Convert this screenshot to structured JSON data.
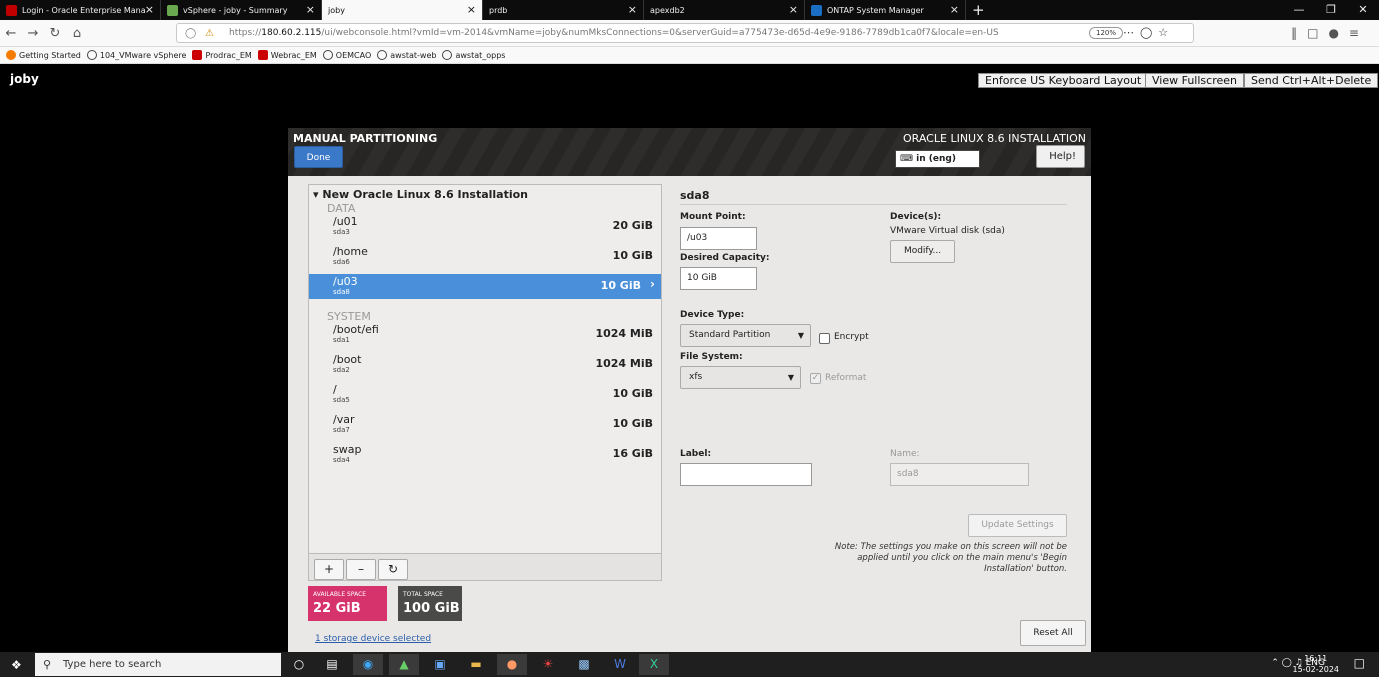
{
  "browser": {
    "tabs": [
      {
        "label": "Login - Oracle Enterprise Mana",
        "icon": "oracle-icon",
        "color": "#c00000"
      },
      {
        "label": "vSphere - joby - Summary",
        "icon": "vsphere-icon",
        "color": "#6aa84f"
      },
      {
        "label": "joby",
        "icon": "",
        "color": ""
      },
      {
        "label": "prdb",
        "icon": "",
        "color": ""
      },
      {
        "label": "apexdb2",
        "icon": "",
        "color": ""
      },
      {
        "label": "ONTAP System Manager",
        "icon": "netapp-icon",
        "color": "#1a6fc4"
      }
    ],
    "active_tab": 2,
    "url_prefix": "https://",
    "url_host": "180.60.2.115",
    "url_path": "/ui/webconsole.html?vmId=vm-2014&vmName=joby&numMksConnections=0&serverGuid=a775473e-d65d-4e9e-9186-7789db1ca0f7&locale=en-US",
    "zoom": "120%",
    "bookmarks": [
      "Getting Started",
      "104_VMware vSphere",
      "Prodrac_EM",
      "Webrac_EM",
      "OEMCAO",
      "awstat-web",
      "awstat_opps"
    ]
  },
  "console": {
    "vm_name": "joby",
    "enforce_label": "Enforce US Keyboard Layout",
    "fullscreen_label": "View Fullscreen",
    "cad_label": "Send Ctrl+Alt+Delete"
  },
  "installer": {
    "title": "MANUAL PARTITIONING",
    "done_label": "Done",
    "right_title": "ORACLE LINUX 8.6 INSTALLATION",
    "keyboard": "in (eng)",
    "help_label": "Help!",
    "group_title": "New Oracle Linux 8.6 Installation",
    "sections": [
      {
        "name": "DATA",
        "mounts": [
          {
            "mount": "/u01",
            "device": "sda3",
            "size": "20 GiB",
            "selected": false
          },
          {
            "mount": "/home",
            "device": "sda6",
            "size": "10 GiB",
            "selected": false
          },
          {
            "mount": "/u03",
            "device": "sda8",
            "size": "10 GiB",
            "selected": true
          }
        ]
      },
      {
        "name": "SYSTEM",
        "mounts": [
          {
            "mount": "/boot/efi",
            "device": "sda1",
            "size": "1024 MiB",
            "selected": false
          },
          {
            "mount": "/boot",
            "device": "sda2",
            "size": "1024 MiB",
            "selected": false
          },
          {
            "mount": "/",
            "device": "sda5",
            "size": "10 GiB",
            "selected": false
          },
          {
            "mount": "/var",
            "device": "sda7",
            "size": "10 GiB",
            "selected": false
          },
          {
            "mount": "swap",
            "device": "sda4",
            "size": "16 GiB",
            "selected": false
          }
        ]
      }
    ],
    "available_label": "AVAILABLE SPACE",
    "available_value": "22 GiB",
    "total_label": "TOTAL SPACE",
    "total_value": "100 GiB",
    "storage_link": "1 storage device selected",
    "reset_label": "Reset All",
    "detail": {
      "title": "sda8",
      "mount_label": "Mount Point:",
      "mount_value": "/u03",
      "capacity_label": "Desired Capacity:",
      "capacity_value": "10 GiB",
      "devices_label": "Device(s):",
      "devices_value": "VMware Virtual disk (sda)",
      "modify_label": "Modify...",
      "device_type_label": "Device Type:",
      "device_type_value": "Standard Partition",
      "encrypt_label": "Encrypt",
      "fs_label": "File System:",
      "fs_value": "xfs",
      "reformat_label": "Reformat",
      "label_label": "Label:",
      "label_value": "",
      "name_label": "Name:",
      "name_value": "sda8",
      "update_label": "Update Settings",
      "note": "Note:  The settings you make on this screen will not be applied until you click on the main menu's 'Begin Installation' button."
    },
    "colors": {
      "available": "#d6336c",
      "total": "#4a4a48",
      "selected": "#4a8fd9",
      "done": "#3a79c7"
    }
  },
  "taskbar": {
    "search_placeholder": "Type here to search",
    "tray_lang": "ENG",
    "time": "16:11",
    "date": "15-02-2024"
  }
}
